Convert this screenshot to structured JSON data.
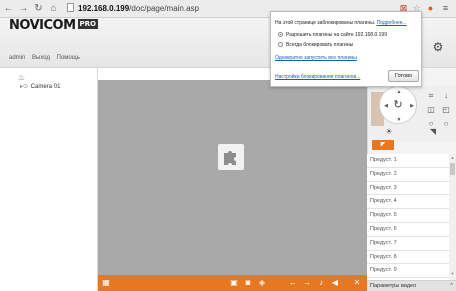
{
  "browser": {
    "url_host": "192.168.0.199",
    "url_path": "/doc/page/main.asp"
  },
  "app": {
    "logo_brand": "NOVICOM",
    "logo_badge": "PRO",
    "menu": [
      "admin",
      "Выход",
      "Помощь"
    ]
  },
  "tree": {
    "camera": "Camera 01"
  },
  "popup": {
    "message": "На этой странице заблокированы плагины.",
    "more_link": "Подробнее...",
    "option_allow": "Разрешить плагины на сайте 192.168.0.199",
    "option_block": "Всегда блокировать плагины",
    "run_once_link": "Однократно запустить все плагины",
    "settings_link": "Настройки блокирования плагинов...",
    "done_button": "Готово"
  },
  "presets": [
    "Предуст. 1",
    "Предуст. 2",
    "Предуст. 3",
    "Предуст. 4",
    "Предуст. 5",
    "Предуст. 6",
    "Предуст. 7",
    "Предуст. 8",
    "Предуст. 9"
  ],
  "settings_bar": {
    "label": "Параметры видео"
  },
  "colors": {
    "accent": "#e87722",
    "video_bg": "#a9a9a9",
    "link": "#1a5bb5"
  }
}
